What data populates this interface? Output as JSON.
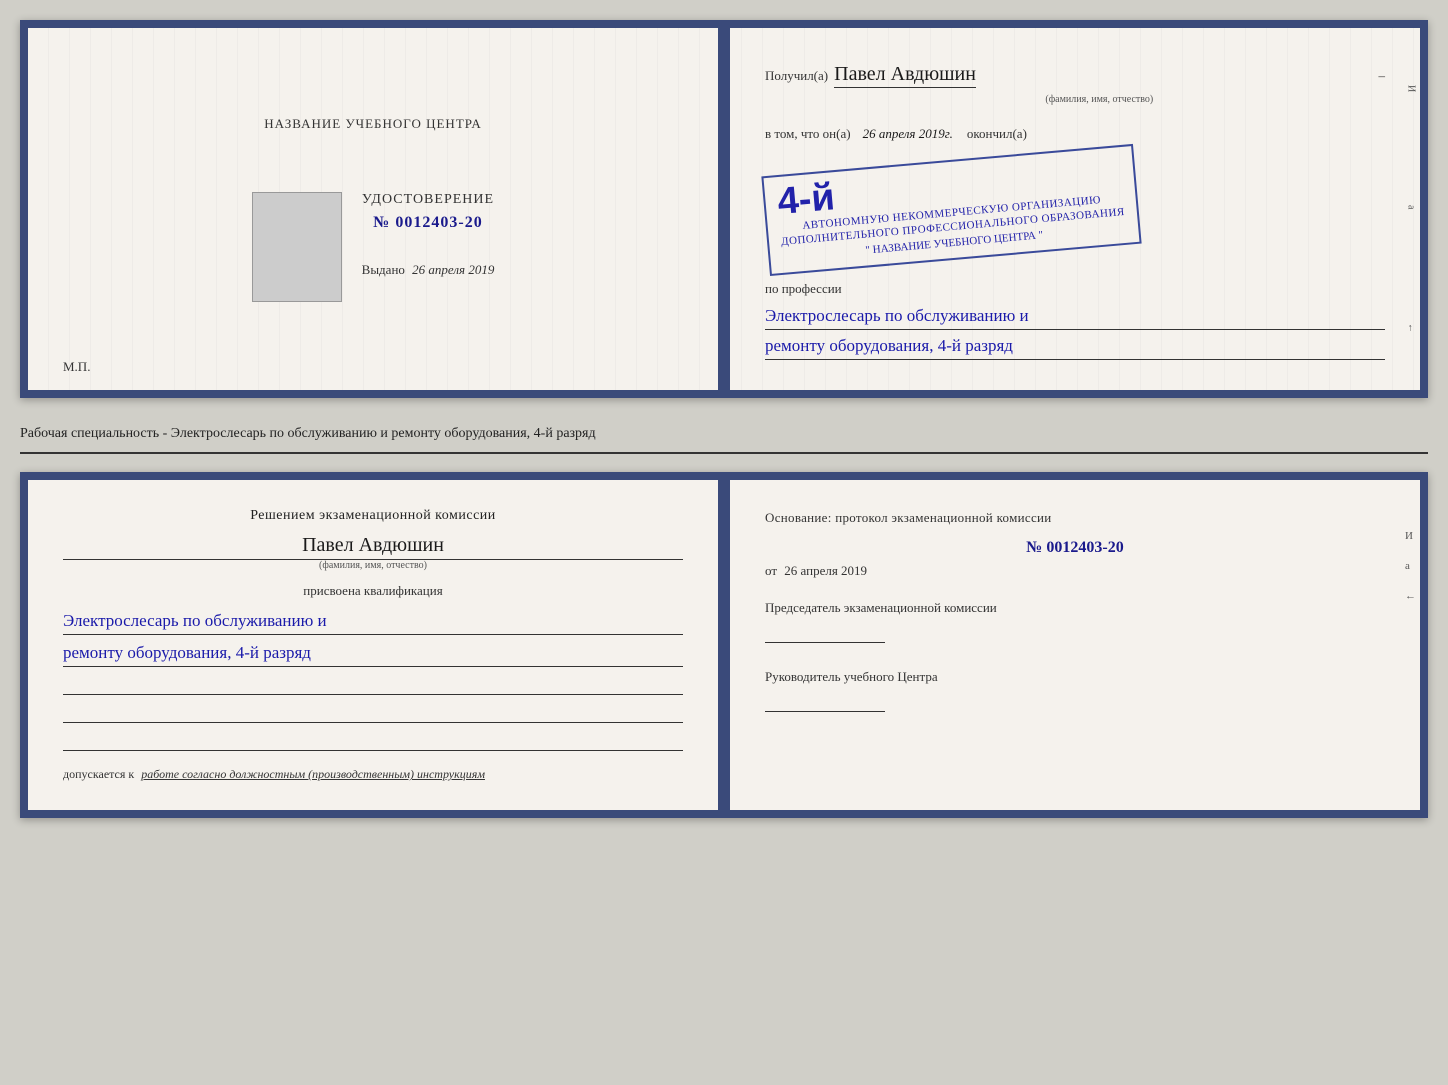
{
  "top_booklet": {
    "left": {
      "учебный_центр": "НАЗВАНИЕ УЧЕБНОГО ЦЕНТРА",
      "удостоверение": "УДОСТОВЕРЕНИЕ",
      "номер": "№ 0012403-20",
      "выдано_label": "Выдано",
      "выдано_date": "26 апреля 2019",
      "mp": "М.П."
    },
    "right": {
      "получил_label": "Получил(а)",
      "получил_name": "Павел Авдюшин",
      "фио_subtitle": "(фамилия, имя, отчество)",
      "vtom_label": "в том, что он(а)",
      "vtom_date": "26 апреля 2019г.",
      "okoncil_label": "окончил(а)",
      "rank": "4-й",
      "org_line1": "АВТОНОМНУЮ НЕКОММЕРЧЕСКУЮ ОРГАНИЗАЦИЮ",
      "org_line2": "ДОПОЛНИТЕЛЬНОГО ПРОФЕССИОНАЛЬНОГО ОБРАЗОВАНИЯ",
      "org_name": "\" НАЗВАНИЕ УЧЕБНОГО ЦЕНТРА \"",
      "po_professii_label": "по профессии",
      "profession_line1": "Электрослесарь по обслуживанию и",
      "profession_line2": "ремонту оборудования, 4-й разряд"
    }
  },
  "middle": {
    "text": "Рабочая специальность - Электрослесарь по обслуживанию и ремонту оборудования, 4-й разряд"
  },
  "bottom_booklet": {
    "left": {
      "resheniem_label": "Решением экзаменационной комиссии",
      "name": "Павел Авдюшин",
      "fio_subtitle": "(фамилия, имя, отчество)",
      "prisvоена_label": "присвоена квалификация",
      "kvalif_line1": "Электрослесарь по обслуживанию и",
      "kvalif_line2": "ремонту оборудования, 4-й разряд",
      "dopusk_label": "допускается к",
      "dopusk_text": "работе согласно должностным (производственным) инструкциям"
    },
    "right": {
      "osnovanie_label": "Основание: протокол экзаменационной комиссии",
      "protocol_num": "№ 0012403-20",
      "ot_label": "от",
      "ot_date": "26 апреля 2019",
      "predsedatel_label": "Председатель экзаменационной комиссии",
      "rukovoditel_label": "Руководитель учебного Центра"
    }
  },
  "edge_marks": {
    "right1": "И",
    "right2": "а",
    "right3": "←"
  }
}
